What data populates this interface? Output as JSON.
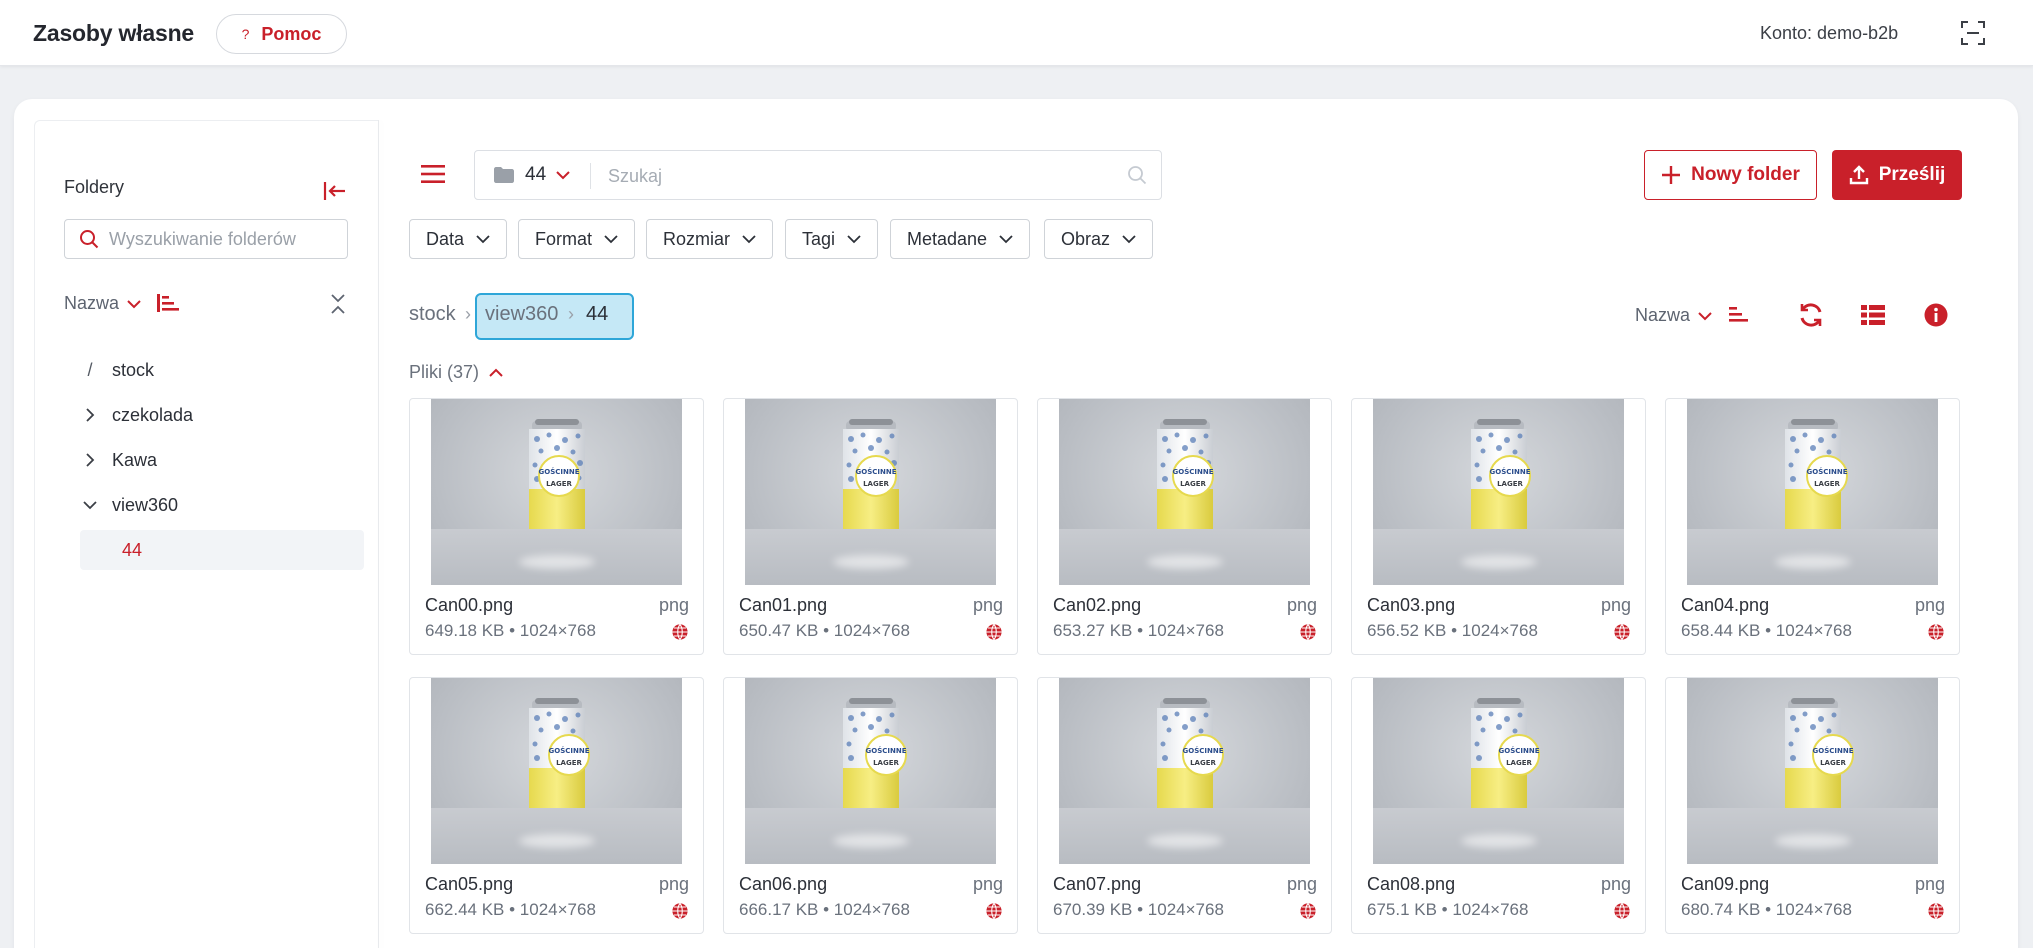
{
  "header": {
    "title": "Zasoby własne",
    "help_label": "Pomoc",
    "help_glyph": "?",
    "account": "Konto: demo-b2b"
  },
  "sidebar": {
    "title": "Foldery",
    "search_placeholder": "Wyszukiwanie folderów",
    "sort_label": "Nazwa",
    "tree": [
      {
        "label": "stock",
        "icon": "slash-icon"
      },
      {
        "label": "czekolada",
        "icon": "chevron-right-icon"
      },
      {
        "label": "Kawa",
        "icon": "chevron-right-icon"
      },
      {
        "label": "view360",
        "icon": "chevron-down-icon"
      },
      {
        "label": "44",
        "selected": true
      }
    ]
  },
  "toolbar": {
    "folder_value": "44",
    "search_placeholder": "Szukaj",
    "new_folder_label": "Nowy folder",
    "upload_label": "Prześlij"
  },
  "filters": [
    "Data",
    "Format",
    "Rozmiar",
    "Tagi",
    "Metadane",
    "Obraz"
  ],
  "breadcrumb": [
    "stock",
    "view360",
    "44"
  ],
  "sort_label": "Nazwa",
  "files_label": "Pliki (37)",
  "files": [
    {
      "name": "Can00.png",
      "ext": "png",
      "meta": "649.18 KB • 1024×768"
    },
    {
      "name": "Can01.png",
      "ext": "png",
      "meta": "650.47 KB • 1024×768"
    },
    {
      "name": "Can02.png",
      "ext": "png",
      "meta": "653.27 KB • 1024×768"
    },
    {
      "name": "Can03.png",
      "ext": "png",
      "meta": "656.52 KB • 1024×768"
    },
    {
      "name": "Can04.png",
      "ext": "png",
      "meta": "658.44 KB • 1024×768"
    },
    {
      "name": "Can05.png",
      "ext": "png",
      "meta": "662.44 KB • 1024×768"
    },
    {
      "name": "Can06.png",
      "ext": "png",
      "meta": "666.17 KB • 1024×768"
    },
    {
      "name": "Can07.png",
      "ext": "png",
      "meta": "670.39 KB • 1024×768"
    },
    {
      "name": "Can08.png",
      "ext": "png",
      "meta": "675.1 KB • 1024×768"
    },
    {
      "name": "Can09.png",
      "ext": "png",
      "meta": "680.74 KB • 1024×768"
    }
  ],
  "thumbnail_label": {
    "brand": "GOŚCINNE",
    "style": "LAGER"
  },
  "colors": {
    "accent": "#c9202a",
    "highlight": "#2ea6d8"
  }
}
